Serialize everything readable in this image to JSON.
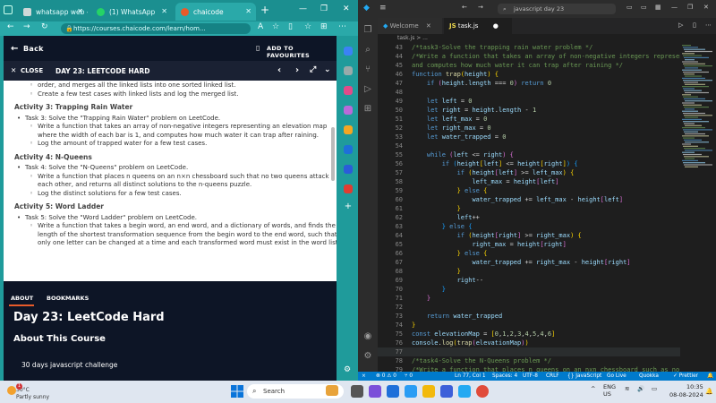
{
  "browser": {
    "tabs": [
      {
        "label": "whatsapp web -",
        "color": "#d9d9d9"
      },
      {
        "label": "(1) WhatsApp",
        "color": "#25d366"
      },
      {
        "label": "chaicode",
        "color": "#e85b2a"
      }
    ],
    "url": "https://courses.chaicode.com/learn/hom..."
  },
  "page": {
    "back_label": "Back",
    "add_fav_label": "ADD TO FAVOURITES",
    "close_label": "CLOSE",
    "lesson_title": "DAY 23: LEETCODE HARD",
    "doc": {
      "intro_lines": [
        "order, and merges all the linked lists into one sorted linked list.",
        "Create a few test cases with linked lists and log the merged list."
      ],
      "activities": [
        {
          "heading": "Activity 3: Trapping Rain Water",
          "task": "Task 3: Solve the \"Trapping Rain Water\" problem on LeetCode.",
          "subs": [
            "Write a function that takes an array of non-negative integers representing an elevation map",
            "where the width of each bar is 1, and computes how much water it can trap after raining.",
            "Log the amount of trapped water for a few test cases."
          ]
        },
        {
          "heading": "Activity 4: N-Queens",
          "task": "Task 4: Solve the \"N-Queens\" problem on LeetCode.",
          "subs": [
            "Write a function that places n queens on an n×n chessboard such that no two queens attack",
            "each other, and returns all distinct solutions to the n-queens puzzle.",
            "Log the distinct solutions for a few test cases."
          ]
        },
        {
          "heading": "Activity 5: Word Ladder",
          "task": "Task 5: Solve the \"Word Ladder\" problem on LeetCode.",
          "subs": [
            "Write a function that takes a begin word, an end word, and a dictionary of words, and finds the",
            "length of the shortest transformation sequence from the begin word to the end word, such that",
            "only one letter can be changed at a time and each transformed word must exist in the word list."
          ]
        }
      ]
    },
    "tab_about": "ABOUT",
    "tab_bookmarks": "BOOKMARKS",
    "course_title": "Day 23: LeetCode Hard",
    "about_heading": "About This Course",
    "course_desc": "30 days javascript challenge"
  },
  "vscode": {
    "search_text": "javascript day 23",
    "tab_welcome": "Welcome",
    "tab_file": "task.js",
    "breadcrumb": "task.js > ...",
    "lines": [
      {
        "n": "43",
        "html": "<span class='c'>/*task3-Solve the trapping rain water problem */</span>"
      },
      {
        "n": "44",
        "html": "<span class='c'>/*Write a function that takes an array of non-negative integers representi</span>"
      },
      {
        "n": "45",
        "html": "<span class='c'>and computes how much water it can trap after raining */</span>"
      },
      {
        "n": "46",
        "html": "<span class='k'>function</span> <span class='f'>trap</span><span class='b1'>(</span><span class='v'>height</span><span class='b1'>)</span> <span class='b1'>{</span>"
      },
      {
        "n": "47",
        "html": "    <span class='k'>if</span> <span class='b2'>(</span><span class='v'>height</span><span class='p'>.</span><span class='v'>length</span> <span class='p'>===</span> <span class='num'>0</span><span class='b2'>)</span> <span class='k'>return</span> <span class='num'>0</span>"
      },
      {
        "n": "48",
        "html": ""
      },
      {
        "n": "49",
        "html": "    <span class='k'>let</span> <span class='v'>left</span> <span class='p'>=</span> <span class='num'>0</span>"
      },
      {
        "n": "50",
        "html": "    <span class='k'>let</span> <span class='v'>right</span> <span class='p'>=</span> <span class='v'>height</span><span class='p'>.</span><span class='v'>length</span> <span class='p'>-</span> <span class='num'>1</span>"
      },
      {
        "n": "51",
        "html": "    <span class='k'>let</span> <span class='v'>left_max</span> <span class='p'>=</span> <span class='num'>0</span>"
      },
      {
        "n": "52",
        "html": "    <span class='k'>let</span> <span class='v'>right_max</span> <span class='p'>=</span> <span class='num'>0</span>"
      },
      {
        "n": "53",
        "html": "    <span class='k'>let</span> <span class='v'>water_trapped</span> <span class='p'>=</span> <span class='num'>0</span>"
      },
      {
        "n": "54",
        "html": ""
      },
      {
        "n": "55",
        "html": "    <span class='k'>while</span> <span class='b2'>(</span><span class='v'>left</span> <span class='p'>&lt;=</span> <span class='v'>right</span><span class='b2'>)</span> <span class='b2'>{</span>"
      },
      {
        "n": "56",
        "html": "        <span class='k'>if</span> <span class='b3'>(</span><span class='v'>height</span><span class='b1'>[</span><span class='v'>left</span><span class='b1'>]</span> <span class='p'>&lt;=</span> <span class='v'>height</span><span class='b1'>[</span><span class='v'>right</span><span class='b1'>]</span><span class='b3'>)</span> <span class='b3'>{</span>"
      },
      {
        "n": "57",
        "html": "            <span class='k'>if</span> <span class='b1'>(</span><span class='v'>height</span><span class='b2'>[</span><span class='v'>left</span><span class='b2'>]</span> <span class='p'>&gt;=</span> <span class='v'>left_max</span><span class='b1'>)</span> <span class='b1'>{</span>"
      },
      {
        "n": "58",
        "html": "                <span class='v'>left_max</span> <span class='p'>=</span> <span class='v'>height</span><span class='b2'>[</span><span class='v'>left</span><span class='b2'>]</span>"
      },
      {
        "n": "59",
        "html": "            <span class='b1'>}</span> <span class='k'>else</span> <span class='b1'>{</span>"
      },
      {
        "n": "60",
        "html": "                <span class='v'>water_trapped</span> <span class='p'>+=</span> <span class='v'>left_max</span> <span class='p'>-</span> <span class='v'>height</span><span class='b2'>[</span><span class='v'>left</span><span class='b2'>]</span>"
      },
      {
        "n": "61",
        "html": "            <span class='b1'>}</span>"
      },
      {
        "n": "62",
        "html": "            <span class='v'>left</span><span class='p'>++</span>"
      },
      {
        "n": "63",
        "html": "        <span class='b3'>}</span> <span class='k'>else</span> <span class='b3'>{</span>"
      },
      {
        "n": "64",
        "html": "            <span class='k'>if</span> <span class='b1'>(</span><span class='v'>height</span><span class='b2'>[</span><span class='v'>right</span><span class='b2'>]</span> <span class='p'>&gt;=</span> <span class='v'>right_max</span><span class='b1'>)</span> <span class='b1'>{</span>"
      },
      {
        "n": "65",
        "html": "                <span class='v'>right_max</span> <span class='p'>=</span> <span class='v'>height</span><span class='b2'>[</span><span class='v'>right</span><span class='b2'>]</span>"
      },
      {
        "n": "66",
        "html": "            <span class='b1'>}</span> <span class='k'>else</span> <span class='b1'>{</span>"
      },
      {
        "n": "67",
        "html": "                <span class='v'>water_trapped</span> <span class='p'>+=</span> <span class='v'>right_max</span> <span class='p'>-</span> <span class='v'>height</span><span class='b2'>[</span><span class='v'>right</span><span class='b2'>]</span>"
      },
      {
        "n": "68",
        "html": "            <span class='b1'>}</span>"
      },
      {
        "n": "69",
        "html": "            <span class='v'>right</span><span class='p'>--</span>"
      },
      {
        "n": "70",
        "html": "        <span class='b3'>}</span>"
      },
      {
        "n": "71",
        "html": "    <span class='b2'>}</span>"
      },
      {
        "n": "72",
        "html": ""
      },
      {
        "n": "73",
        "html": "    <span class='k'>return</span> <span class='v'>water_trapped</span>"
      },
      {
        "n": "74",
        "html": "<span class='b1'>}</span>"
      },
      {
        "n": "75",
        "html": "<span class='k'>const</span> <span class='v'>elevationMap</span> <span class='p'>=</span> <span class='b1'>[</span><span class='num'>0</span><span class='p'>,</span><span class='num'>1</span><span class='p'>,</span><span class='num'>2</span><span class='p'>,</span><span class='num'>3</span><span class='p'>,</span><span class='num'>4</span><span class='p'>,</span><span class='num'>5</span><span class='p'>,</span><span class='num'>4</span><span class='p'>,</span><span class='num'>6</span><span class='b1'>]</span>"
      },
      {
        "n": "76",
        "html": "<span class='v'>console</span><span class='p'>.</span><span class='f'>log</span><span class='b1'>(</span><span class='f'>trap</span><span class='b2'>(</span><span class='v'>elevationMap</span><span class='b2'>)</span><span class='b1'>)</span>"
      },
      {
        "n": "77",
        "html": ""
      },
      {
        "n": "78",
        "html": "<span class='c'>/*task4-Solve the N-Queens problem */</span>"
      },
      {
        "n": "79",
        "html": "<span class='c'>/*Write a function that places n queens on an nxn chessboard such as no tw</span>"
      }
    ],
    "status": {
      "problems": "⊗ 0 ⚠ 0",
      "ports": "⑂ 0",
      "cursor": "Ln 77, Col 1",
      "spaces": "Spaces: 4",
      "encoding": "UTF-8",
      "eol": "CRLF",
      "language": "{} JavaScript",
      "golive": "Go Live",
      "quokka": "Quokka",
      "prettier": "✓ Prettier"
    }
  },
  "taskbar": {
    "weather_temp": "30°C",
    "weather_desc": "Partly sunny",
    "weather_badge": "1",
    "search_label": "Search",
    "lang1": "ENG",
    "lang2": "US",
    "time": "10:35",
    "date": "08-08-2024"
  }
}
